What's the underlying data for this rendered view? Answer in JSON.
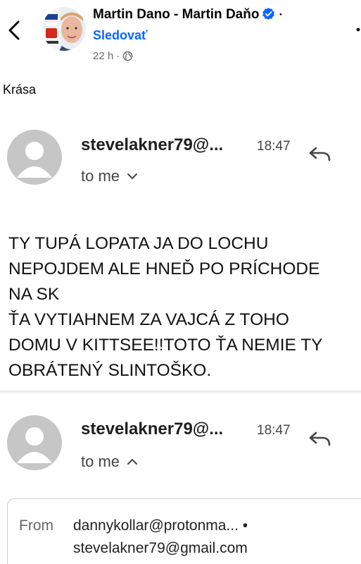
{
  "post": {
    "author": "Martin Dano - Martin Daňo",
    "separator": "·",
    "follow_label": "Sledovať",
    "time_ago": "22 h",
    "meta_dot": "·",
    "privacy_icon": "globe-icon",
    "caption": "Krása",
    "verified_color": "#0866ff"
  },
  "email_thread": {
    "messages": [
      {
        "sender": "stevelakner79@...",
        "time": "18:47",
        "to_label": "to me",
        "expanded": false,
        "body": "TY TUPÁ LOPATA JA DO LOCHU\nNEPOJDEM ALE HNEĎ PO PRÍCHODE\nNA SK\nŤA VYTIAHNEM ZA VAJCÁ Z TOHO\nDOMU V KITTSEE!!TOTO ŤA NEMIE TY\nOBRÁTENÝ SLINTOŠKO."
      },
      {
        "sender": "stevelakner79@...",
        "time": "18:47",
        "to_label": "to me",
        "expanded": true,
        "details": {
          "from_label": "From",
          "from_value": "dannykollar@protonma... •",
          "from_email": "stevelakner79@gmail.com"
        }
      }
    ]
  }
}
